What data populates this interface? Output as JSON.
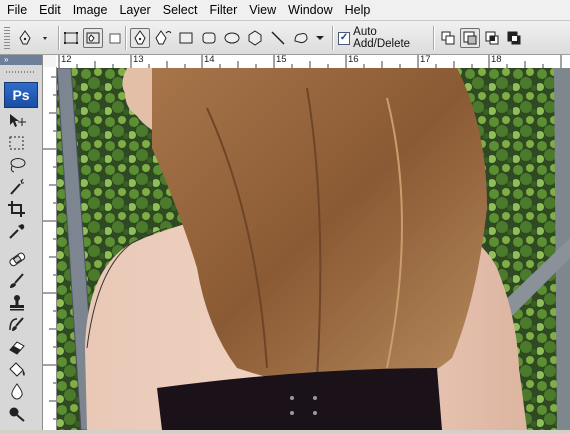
{
  "menu": [
    "File",
    "Edit",
    "Image",
    "Layer",
    "Select",
    "Filter",
    "View",
    "Window",
    "Help"
  ],
  "options": {
    "auto_add_delete_label": "Auto Add/Delete",
    "auto_add_delete_checked": "✓"
  },
  "tools_panel": {
    "logo": "Ps",
    "collapse": "»"
  },
  "ruler": {
    "labels": [
      "12",
      "13",
      "14",
      "15",
      "16",
      "17",
      "18"
    ]
  },
  "canvas": {
    "description_icon": "photo-canvas"
  }
}
